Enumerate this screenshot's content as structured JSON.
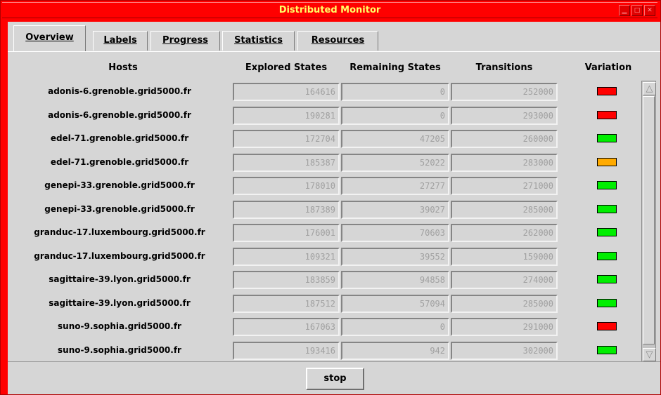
{
  "window": {
    "title": "Distributed Monitor"
  },
  "tabs": [
    {
      "label": "Overview",
      "active": true
    },
    {
      "label": "Labels",
      "active": false
    },
    {
      "label": "Progress",
      "active": false
    },
    {
      "label": "Statistics",
      "active": false
    },
    {
      "label": "Resources",
      "active": false
    }
  ],
  "columns": {
    "hosts": "Hosts",
    "explored": "Explored States",
    "remaining": "Remaining States",
    "transitions": "Transitions",
    "variation": "Variation"
  },
  "colors": {
    "red": "#ff0000",
    "green": "#00ee00",
    "orange": "#ffaa00"
  },
  "rows": [
    {
      "host": "adonis-6.grenoble.grid5000.fr",
      "explored": "164616",
      "remaining": "0",
      "transitions": "252000",
      "variation": "red"
    },
    {
      "host": "adonis-6.grenoble.grid5000.fr",
      "explored": "190281",
      "remaining": "0",
      "transitions": "293000",
      "variation": "red"
    },
    {
      "host": "edel-71.grenoble.grid5000.fr",
      "explored": "172704",
      "remaining": "47205",
      "transitions": "260000",
      "variation": "green"
    },
    {
      "host": "edel-71.grenoble.grid5000.fr",
      "explored": "185387",
      "remaining": "52022",
      "transitions": "283000",
      "variation": "orange"
    },
    {
      "host": "genepi-33.grenoble.grid5000.fr",
      "explored": "178010",
      "remaining": "27277",
      "transitions": "271000",
      "variation": "green"
    },
    {
      "host": "genepi-33.grenoble.grid5000.fr",
      "explored": "187389",
      "remaining": "39027",
      "transitions": "285000",
      "variation": "green"
    },
    {
      "host": "granduc-17.luxembourg.grid5000.fr",
      "explored": "176001",
      "remaining": "70603",
      "transitions": "262000",
      "variation": "green"
    },
    {
      "host": "granduc-17.luxembourg.grid5000.fr",
      "explored": "109321",
      "remaining": "39552",
      "transitions": "159000",
      "variation": "green"
    },
    {
      "host": "sagittaire-39.lyon.grid5000.fr",
      "explored": "183859",
      "remaining": "94858",
      "transitions": "274000",
      "variation": "green"
    },
    {
      "host": "sagittaire-39.lyon.grid5000.fr",
      "explored": "187512",
      "remaining": "57094",
      "transitions": "285000",
      "variation": "green"
    },
    {
      "host": "suno-9.sophia.grid5000.fr",
      "explored": "167063",
      "remaining": "0",
      "transitions": "291000",
      "variation": "red"
    },
    {
      "host": "suno-9.sophia.grid5000.fr",
      "explored": "193416",
      "remaining": "942",
      "transitions": "302000",
      "variation": "green"
    }
  ],
  "footer": {
    "stop_label": "stop"
  }
}
